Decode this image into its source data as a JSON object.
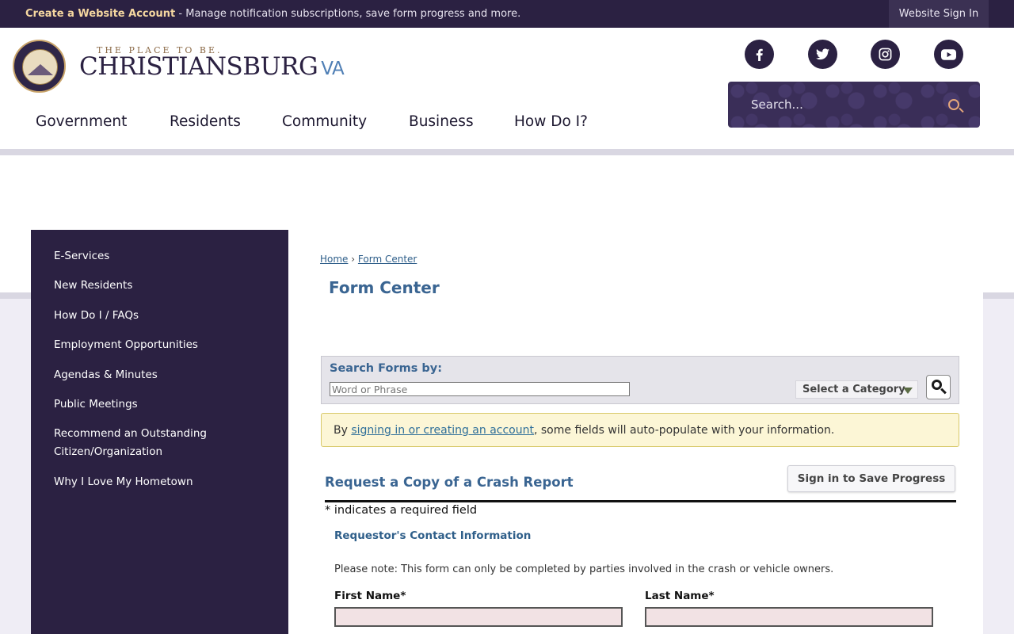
{
  "topbar": {
    "account_link": "Create a Website Account",
    "account_desc": " - Manage notification subscriptions, save form progress and more.",
    "signin": "Website Sign In"
  },
  "header": {
    "tagline": "THE PLACE TO BE.",
    "brand": "CHRISTIANSBURG",
    "brand_suffix": "VA",
    "search_placeholder": "Search...",
    "social": [
      "facebook-icon",
      "twitter-icon",
      "instagram-icon",
      "youtube-icon"
    ],
    "nav": [
      "Government",
      "Residents",
      "Community",
      "Business",
      "How Do I?"
    ]
  },
  "sidebar": {
    "items": [
      "E-Services",
      "New Residents",
      "How Do I / FAQs",
      "Employment Opportunities",
      "Agendas & Minutes",
      "Public Meetings",
      "Recommend an Outstanding Citizen/Organization",
      "Why I Love My Hometown"
    ]
  },
  "breadcrumb": {
    "home": "Home",
    "sep": "›",
    "current": "Form Center"
  },
  "page_title": "Form Center",
  "search_forms": {
    "label": "Search Forms by:",
    "placeholder": "Word or Phrase",
    "category": "Select a Category"
  },
  "notice": {
    "prefix": "By ",
    "link": "signing in or creating an account",
    "suffix": ", some fields will auto-populate with your information."
  },
  "form": {
    "title": "Request a Copy of a Crash Report",
    "save_button": "Sign in to Save Progress",
    "required_note": "* indicates a required field",
    "section": "Requestor's Contact Information",
    "note": "Please note: This form can only be completed by parties involved in the crash or vehicle owners.",
    "first_name_label": "First Name*",
    "last_name_label": "Last Name*"
  },
  "colors": {
    "brand_purple": "#2b2142",
    "link_blue": "#3a6592",
    "notice_bg": "#fcf6d6",
    "required_input_bg": "#f2e2e4"
  }
}
